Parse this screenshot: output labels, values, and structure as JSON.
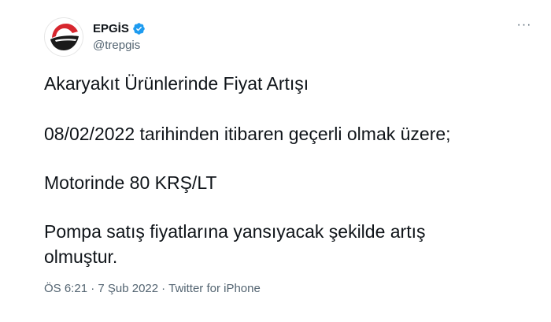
{
  "tweet": {
    "display_name": "EPGİS",
    "handle": "@trepgis",
    "more_label": "···",
    "lines": [
      "Akaryakıt Ürünlerinde Fiyat Artışı",
      "08/02/2022 tarihinden itibaren geçerli olmak üzere;",
      "Motorinde 80 KRŞ/LT",
      "Pompa satış fiyatlarına yansıyacak şekilde artış olmuştur."
    ],
    "timestamp": "ÖS 6:21 · 7 Şub 2022",
    "separator": "·",
    "source": "Twitter for iPhone"
  },
  "colors": {
    "text": "#0f1419",
    "secondary": "#536471",
    "verified": "#1d9bf0",
    "logo_red": "#d7262e",
    "logo_black": "#1a1a1a"
  },
  "icons": {
    "avatar": "epgis-logo",
    "verified": "verified-badge-icon",
    "more": "more-options-icon"
  }
}
